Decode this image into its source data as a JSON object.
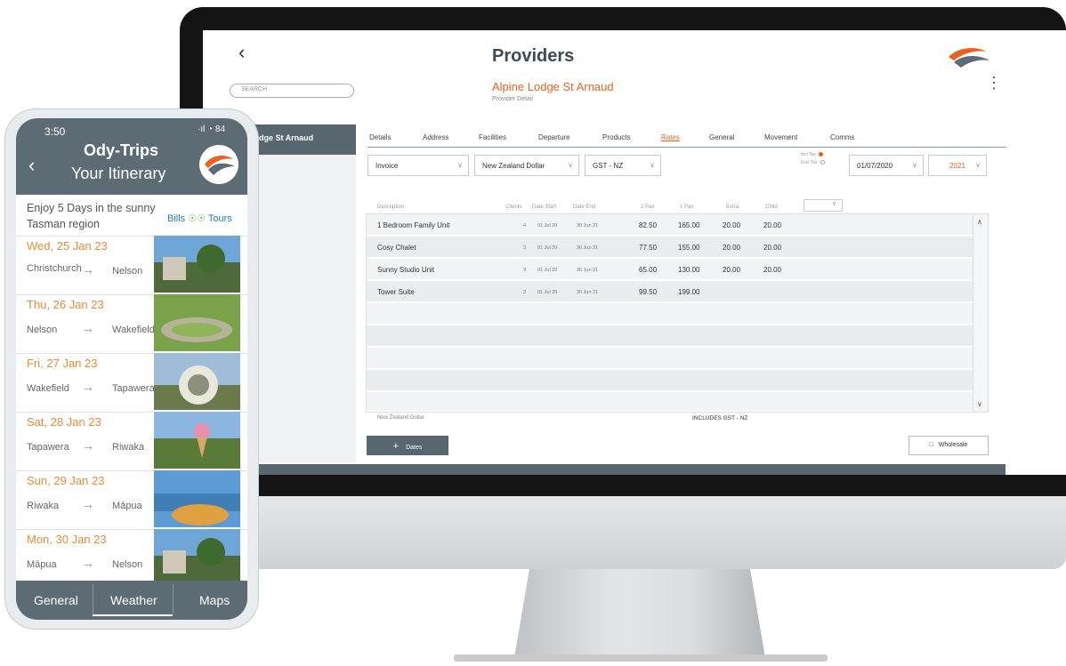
{
  "desktop": {
    "page_title": "Providers",
    "search_placeholder": "SEARCH",
    "provider_name": "Alpine Lodge St Arnaud",
    "provider_subtitle": "Provider Detail",
    "sidebar_active": "Lodge St Arnaud",
    "tabs": [
      "Details",
      "Address",
      "Facilities",
      "Departure",
      "Products",
      "Rates",
      "General",
      "Movement",
      "Comms"
    ],
    "active_tab": "Rates",
    "filters": {
      "type": "Invoice",
      "currency": "New Zealand Dollar",
      "tax": "GST - NZ",
      "incl_tax": "Incl Tax",
      "excl_tax": "Excl Tax",
      "date": "01/07/2020",
      "year": "2021"
    },
    "columns": [
      "Description",
      "Clients",
      "Date Start",
      "Date End",
      "2 Pax",
      "1 Pax",
      "Extra",
      "Child"
    ],
    "rows": [
      {
        "desc": "1 Bedroom Family Unit",
        "clients": "4",
        "start": "01 Jul 20",
        "end": "30 Jun 21",
        "pax2": "82.50",
        "pax1": "165.00",
        "extra": "20.00",
        "child": "20.00"
      },
      {
        "desc": "Cosy Chalet",
        "clients": "3",
        "start": "01 Jul 20",
        "end": "30 Jun 21",
        "pax2": "77.50",
        "pax1": "155.00",
        "extra": "20.00",
        "child": "20.00"
      },
      {
        "desc": "Sunny Studio Unit",
        "clients": "3",
        "start": "01 Jul 20",
        "end": "30 Jun 21",
        "pax2": "65.00",
        "pax1": "130.00",
        "extra": "20.00",
        "child": "20.00"
      },
      {
        "desc": "Tower Suite",
        "clients": "2",
        "start": "01 Jul 20",
        "end": "30 Jun 21",
        "pax2": "99.50",
        "pax1": "199.00",
        "extra": "",
        "child": ""
      }
    ],
    "footer_currency": "New Zealand Dollar",
    "footer_gst": "INCLUDES GST - NZ",
    "dates_button": "Dates",
    "wholesale_button": "Wholesale",
    "accent": "#e8631f",
    "slate": "#586670"
  },
  "phone": {
    "time": "3:50",
    "status": "·ıl ◔ 84",
    "title": "Ody-Trips",
    "subtitle": "Your Itinerary",
    "intro": "Enjoy 5 Days in the sunny Tasman region",
    "partner_a": "Bills",
    "partner_b": "Tours",
    "days": [
      {
        "date": "Wed, 25 Jan 23",
        "from": "Christchurch",
        "to": "Nelson"
      },
      {
        "date": "Thu, 26 Jan 23",
        "from": "Nelson",
        "to": "Wakefield"
      },
      {
        "date": "Fri, 27 Jan 23",
        "from": "Wakefield",
        "to": "Tapawera"
      },
      {
        "date": "Sat, 28 Jan 23",
        "from": "Tapawera",
        "to": "Riwaka"
      },
      {
        "date": "Sun, 29 Jan 23",
        "from": "Riwaka",
        "to": "Māpua"
      },
      {
        "date": "Mon, 30 Jan 23",
        "from": "Māpua",
        "to": "Nelson"
      }
    ],
    "tabs": [
      "General",
      "Weather",
      "Maps"
    ],
    "header_color": "#5d6b75",
    "date_color": "#e88b3a"
  }
}
